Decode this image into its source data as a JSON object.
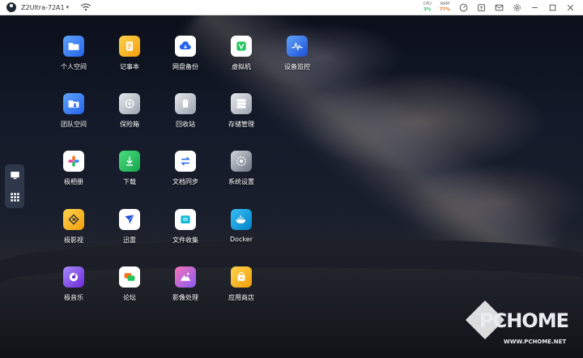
{
  "topbar": {
    "device_name": "Z2Ultra-72A1",
    "cpu": {
      "label": "CPU",
      "value": "3%",
      "color": "#22c55e"
    },
    "ram": {
      "label": "RAM",
      "value": "77%",
      "color": "#f97316"
    }
  },
  "apps": [
    {
      "label": "个人空间",
      "icon": "folder-icon",
      "color": "#3b82f6"
    },
    {
      "label": "记事本",
      "icon": "notepad-icon",
      "color": "#f59e0b"
    },
    {
      "label": "网盘备份",
      "icon": "cloud-backup-icon",
      "color": "#2563eb"
    },
    {
      "label": "虚拟机",
      "icon": "virtual-machine-icon",
      "color": "#22c55e"
    },
    {
      "label": "设备监控",
      "icon": "monitor-chart-icon",
      "color": "#3b82f6"
    },
    {
      "label": "团队空间",
      "icon": "team-folder-icon",
      "color": "#3b82f6"
    },
    {
      "label": "保险箱",
      "icon": "safe-icon",
      "color": "#9ca3af"
    },
    {
      "label": "回收站",
      "icon": "trash-icon",
      "color": "#9ca3af"
    },
    {
      "label": "存储管理",
      "icon": "storage-icon",
      "color": "#9ca3af"
    },
    {
      "label": "极相册",
      "icon": "photos-icon",
      "color": "#ffffff"
    },
    {
      "label": "下载",
      "icon": "download-icon",
      "color": "#22c55e"
    },
    {
      "label": "文档同步",
      "icon": "sync-icon",
      "color": "#ffffff"
    },
    {
      "label": "系统设置",
      "icon": "settings-icon",
      "color": "#9ca3af"
    },
    {
      "label": "极影视",
      "icon": "video-icon",
      "color": "#f59e0b"
    },
    {
      "label": "迅雷",
      "icon": "thunder-icon",
      "color": "#ffffff"
    },
    {
      "label": "文件收集",
      "icon": "file-collect-icon",
      "color": "#ffffff"
    },
    {
      "label": "Docker",
      "icon": "docker-icon",
      "color": "#0ea5e9"
    },
    {
      "label": "极音乐",
      "icon": "music-icon",
      "color": "#7c3aed"
    },
    {
      "label": "论坛",
      "icon": "forum-icon",
      "color": "#ffffff"
    },
    {
      "label": "影像处理",
      "icon": "image-processing-icon",
      "color": "#ec4899"
    },
    {
      "label": "应用商店",
      "icon": "app-store-icon",
      "color": "#f59e0b"
    }
  ],
  "watermark": {
    "brand": "PCHOME",
    "url": "WWW.PCHOME.NET"
  }
}
